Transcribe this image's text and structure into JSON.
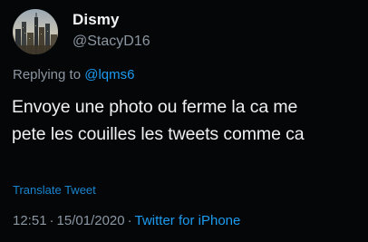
{
  "author": {
    "display_name": "Dismy",
    "handle": "@StacyD16",
    "avatar_icon": "city-skyline-avatar"
  },
  "reply": {
    "prefix": "Replying to",
    "mention": "@lqms6"
  },
  "tweet": {
    "text_line1": "Envoye une photo ou ferme la ca me",
    "text_line2": "pete les couilles les tweets comme ca"
  },
  "translate_label": "Translate Tweet",
  "meta": {
    "time": "12:51",
    "separator": "·",
    "date": "15/01/2020",
    "source": "Twitter for iPhone"
  },
  "colors": {
    "background": "#050608",
    "accent": "#1d9bf0",
    "secondary_text": "#8b96a1",
    "primary_text": "#eef0f2"
  }
}
